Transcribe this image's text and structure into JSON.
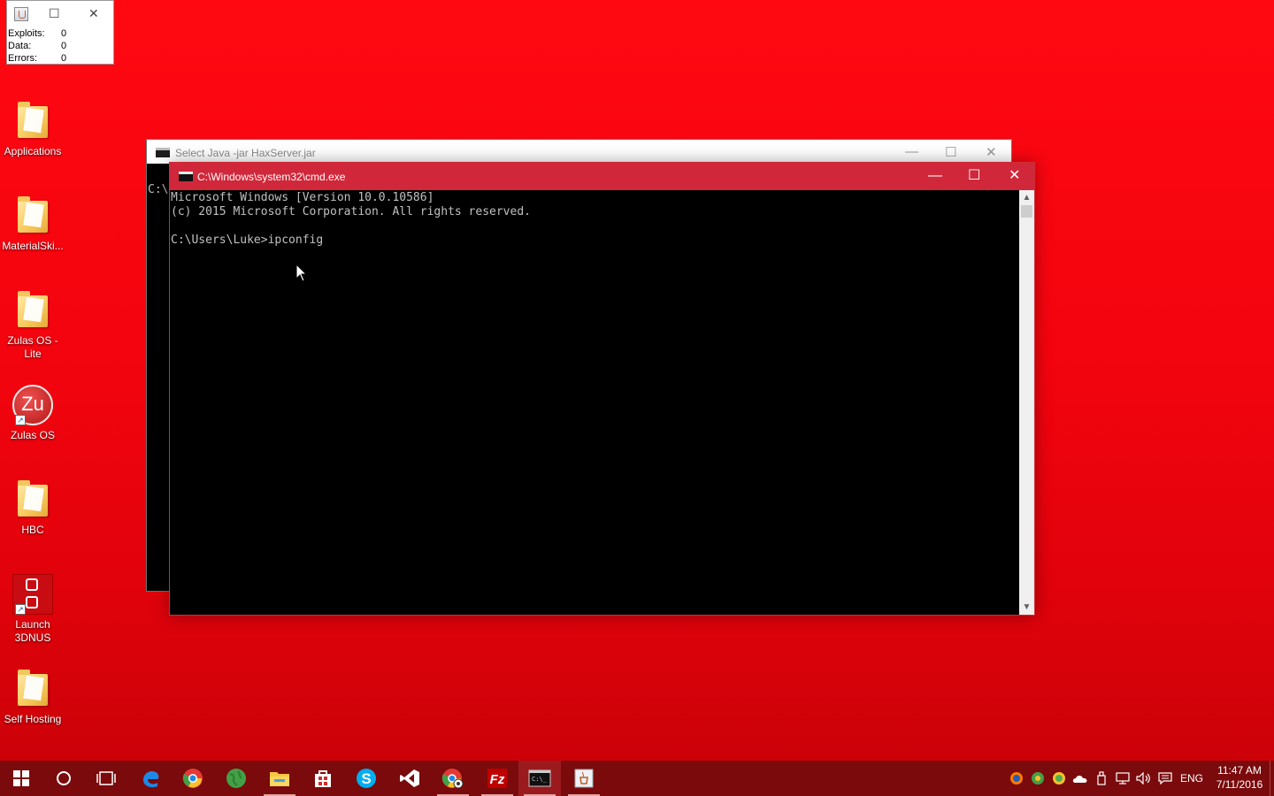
{
  "stats_window": {
    "rows": [
      {
        "label": "Exploits:",
        "value": "0"
      },
      {
        "label": "Data:",
        "value": "0"
      },
      {
        "label": "Errors:",
        "value": "0"
      }
    ]
  },
  "desktop_icons": [
    {
      "label": "Applications",
      "icon": "folder-icon"
    },
    {
      "label": "MaterialSki...",
      "icon": "folder-icon"
    },
    {
      "label": "Zulas OS - Lite",
      "icon": "folder-icon"
    },
    {
      "label": "Zulas OS",
      "icon": "zulas-os-icon",
      "glyph_text": "Zu"
    },
    {
      "label": "HBC",
      "icon": "folder-icon"
    },
    {
      "label": "Launch 3DNUS",
      "icon": "3dnus-icon"
    },
    {
      "label": "Self Hosting",
      "icon": "folder-icon"
    }
  ],
  "java_window": {
    "title": "Select Java  -jar HaxServer.jar",
    "content": "C:\\"
  },
  "cmd_window": {
    "title": "C:\\Windows\\system32\\cmd.exe",
    "lines": [
      "Microsoft Windows [Version 10.0.10586]",
      "(c) 2015 Microsoft Corporation. All rights reserved.",
      "",
      "C:\\Users\\Luke>ipconfig"
    ]
  },
  "taskbar": {
    "apps": [
      "start-icon",
      "cortana-icon",
      "task-view-icon",
      "edge-icon",
      "chrome-icon",
      "globe-app-icon",
      "file-explorer-icon",
      "store-icon",
      "skype-icon",
      "visual-studio-icon",
      "chrome-profile-icon",
      "filezilla-icon",
      "cmd-icon",
      "java-icon"
    ],
    "tray_language": "ENG",
    "time": "11:47 AM",
    "date": "7/11/2016"
  },
  "colors": {
    "desktop_red": "#ff0812",
    "taskbar": "#7a0a0c",
    "cmd_titlebar": "#d0283a",
    "console_text": "#c0c0c0"
  }
}
